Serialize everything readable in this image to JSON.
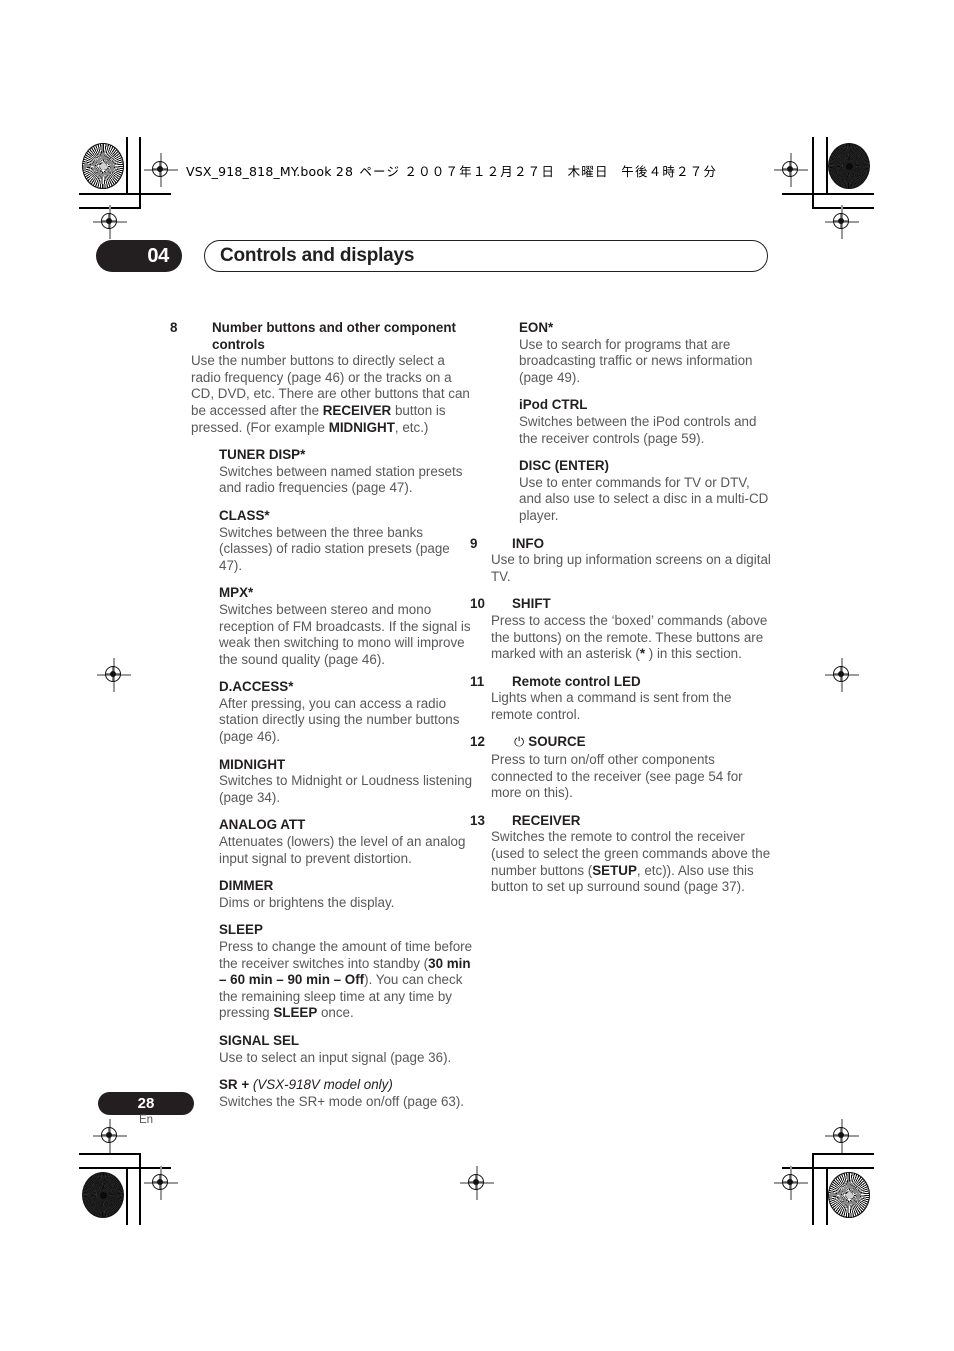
{
  "printer_header": {
    "filename": "VSX_918_818_MY.book",
    "page_label": "28 ページ",
    "date": "２００７年１２月２７日",
    "weekday": "木曜日",
    "time": "午後４時２７分"
  },
  "chapter": {
    "number": "04",
    "title": "Controls and displays"
  },
  "footer": {
    "page_number": "28",
    "language": "En"
  },
  "left_column": [
    {
      "id": "number-buttons",
      "number": "8",
      "heading": "Number buttons and other component controls",
      "indent": false,
      "body_parts": [
        {
          "text": "Use the number buttons to directly select a radio frequency (page 46) or the tracks on a CD, DVD, etc. There are other buttons that can be accessed after the ",
          "bold": false
        },
        {
          "text": "RECEIVER",
          "bold": true
        },
        {
          "text": " button is pressed. (For example ",
          "bold": false
        },
        {
          "text": "MIDNIGHT",
          "bold": true
        },
        {
          "text": ", etc.)",
          "bold": false
        }
      ]
    },
    {
      "id": "tuner-disp",
      "number": "",
      "heading": "TUNER DISP*",
      "indent": true,
      "body_parts": [
        {
          "text": "Switches between named station presets and radio frequencies (page 47).",
          "bold": false
        }
      ]
    },
    {
      "id": "class",
      "number": "",
      "heading": "CLASS*",
      "indent": true,
      "body_parts": [
        {
          "text": "Switches between the three banks (classes) of radio station presets (page 47).",
          "bold": false
        }
      ]
    },
    {
      "id": "mpx",
      "number": "",
      "heading": "MPX*",
      "indent": true,
      "body_parts": [
        {
          "text": "Switches between stereo and mono reception of FM broadcasts. If the signal is weak then switching to mono will improve the sound quality (page 46).",
          "bold": false
        }
      ]
    },
    {
      "id": "d-access",
      "number": "",
      "heading": "D.ACCESS*",
      "indent": true,
      "body_parts": [
        {
          "text": "After pressing, you can access a radio station directly using the number buttons (page 46).",
          "bold": false
        }
      ]
    },
    {
      "id": "midnight",
      "number": "",
      "heading": "MIDNIGHT",
      "indent": true,
      "body_parts": [
        {
          "text": "Switches to Midnight or Loudness listening (page 34).",
          "bold": false
        }
      ]
    },
    {
      "id": "analog-att",
      "number": "",
      "heading": "ANALOG ATT",
      "indent": true,
      "body_parts": [
        {
          "text": "Attenuates (lowers) the level of an analog input signal to prevent distortion.",
          "bold": false
        }
      ]
    },
    {
      "id": "dimmer",
      "number": "",
      "heading": "DIMMER",
      "indent": true,
      "body_parts": [
        {
          "text": "Dims or brightens the display.",
          "bold": false
        }
      ]
    },
    {
      "id": "sleep",
      "number": "",
      "heading": "SLEEP",
      "indent": true,
      "body_parts": [
        {
          "text": "Press to change the amount of time before the receiver switches into standby (",
          "bold": false
        },
        {
          "text": "30 min – 60 min – 90 min – Off",
          "bold": true
        },
        {
          "text": "). You can check the remaining sleep time at any time by pressing ",
          "bold": false
        },
        {
          "text": "SLEEP",
          "bold": true
        },
        {
          "text": " once.",
          "bold": false
        }
      ]
    },
    {
      "id": "signal-sel",
      "number": "",
      "heading": "SIGNAL SEL",
      "indent": true,
      "body_parts": [
        {
          "text": "Use to select an input signal (page 36).",
          "bold": false
        }
      ]
    },
    {
      "id": "sr-plus",
      "number": "",
      "heading": "SR +",
      "heading_italic": " (VSX-918V model only)",
      "indent": true,
      "body_parts": [
        {
          "text": "Switches the SR+ mode on/off (page 63).",
          "bold": false
        }
      ]
    }
  ],
  "right_column": [
    {
      "id": "eon",
      "number": "",
      "heading": "EON*",
      "indent": true,
      "body_parts": [
        {
          "text": "Use to search for programs that are broadcasting traffic or news information (page 49).",
          "bold": false
        }
      ]
    },
    {
      "id": "ipod-ctrl",
      "number": "",
      "heading": "iPod CTRL",
      "indent": true,
      "body_parts": [
        {
          "text": "Switches between the iPod controls and the receiver controls (page 59).",
          "bold": false
        }
      ]
    },
    {
      "id": "disc-enter",
      "number": "",
      "heading": "DISC (ENTER)",
      "indent": true,
      "body_parts": [
        {
          "text": "Use to enter commands for TV or DTV, and also use to select a disc in a multi-CD player.",
          "bold": false
        }
      ]
    },
    {
      "id": "info",
      "number": "9",
      "heading": "INFO",
      "indent": false,
      "body_parts": [
        {
          "text": "Use to bring up information screens on a digital TV.",
          "bold": false
        }
      ]
    },
    {
      "id": "shift",
      "number": "10",
      "heading": "SHIFT",
      "indent": false,
      "body_parts": [
        {
          "text": "Press to access the ‘boxed’ commands (above the buttons) on the remote. These buttons are marked with an asterisk (",
          "bold": false
        },
        {
          "text": "*",
          "bold": true
        },
        {
          "text": " ) in this section.",
          "bold": false
        }
      ]
    },
    {
      "id": "remote-control-led",
      "number": "11",
      "heading": "Remote control LED",
      "indent": false,
      "body_parts": [
        {
          "text": "Lights when a command is sent from the remote control.",
          "bold": false
        }
      ]
    },
    {
      "id": "source",
      "number": "12",
      "heading": "SOURCE",
      "power_icon": "⏻",
      "indent": false,
      "body_parts": [
        {
          "text": "Press to turn on/off other components connected to the receiver (see page 54 for more on this).",
          "bold": false
        }
      ]
    },
    {
      "id": "receiver",
      "number": "13",
      "heading": "RECEIVER",
      "indent": false,
      "body_parts": [
        {
          "text": "Switches the remote to control the receiver (used to select the green commands above the number buttons (",
          "bold": false
        },
        {
          "text": "SETUP",
          "bold": true
        },
        {
          "text": ", etc)). Also use this button to set up surround sound (page 37).",
          "bold": false
        }
      ]
    }
  ],
  "colors": {
    "ink_black": "#231f20",
    "body_gray": "#58585b",
    "paper": "#ffffff"
  }
}
